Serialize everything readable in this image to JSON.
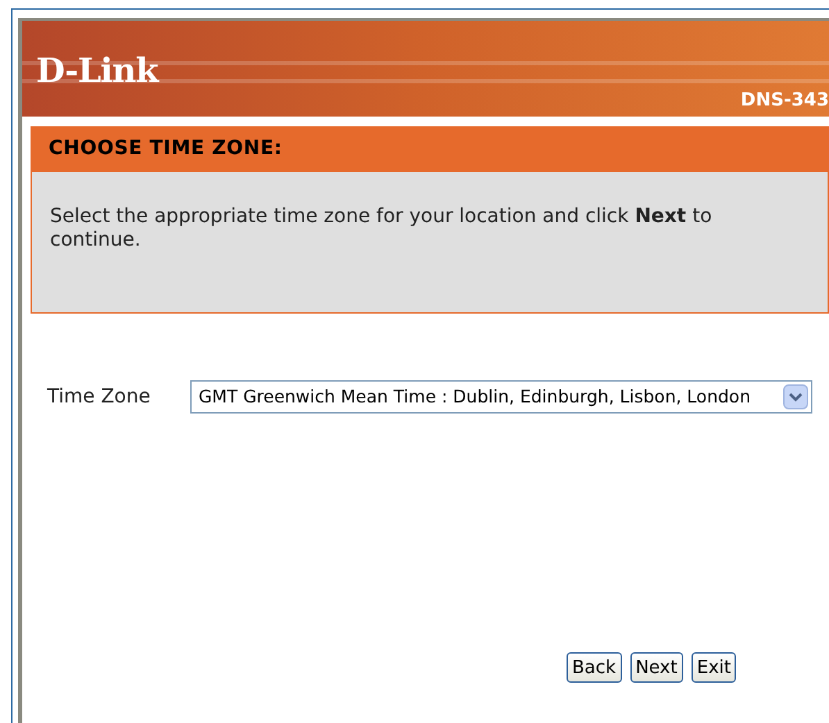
{
  "header": {
    "logo": "D-Link",
    "model": "DNS-343"
  },
  "section": {
    "title": "CHOOSE TIME ZONE:",
    "instruction": "Select the appropriate time zone for your location and click **Next** to continue."
  },
  "time_zone": {
    "label": "Time Zone",
    "value": "GMT Greenwich Mean Time : Dublin, Edinburgh, Lisbon, London"
  },
  "buttons": [
    "Back",
    "Next",
    "Exit"
  ]
}
